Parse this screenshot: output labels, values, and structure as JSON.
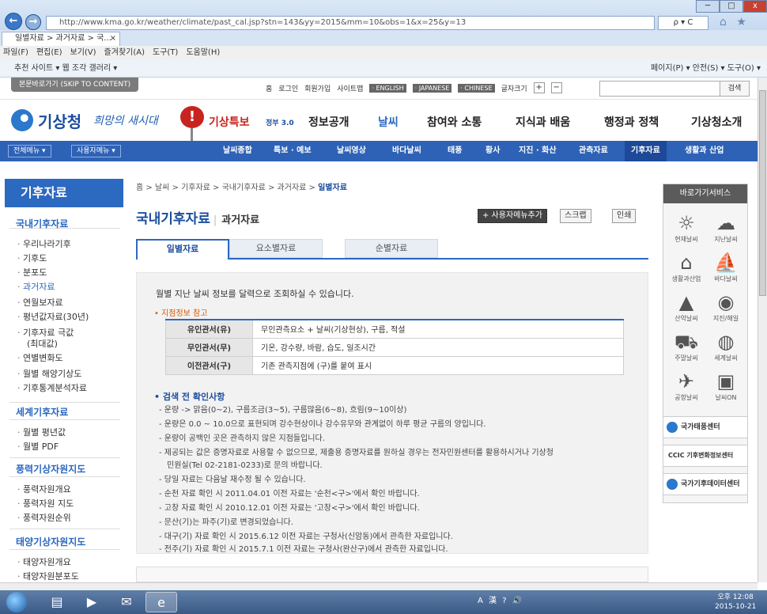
{
  "browser": {
    "back": "←",
    "forward": "→",
    "url": "http://www.kma.go.kr/weather/climate/past_cal.jsp?stn=143&yy=2015&mm=10&obs=1&x=25&y=13",
    "addr_icons": "ρ ▾ C",
    "tab_title": "일별자료 > 과거자료 > 국...",
    "tab_close": "×",
    "home_icons": "⌂ ★ ⚙",
    "win_ctrl": [
      "─",
      "□",
      "x"
    ],
    "menu": [
      "파일(F)",
      "편집(E)",
      "보기(V)",
      "즐겨찾기(A)",
      "도구(T)",
      "도움말(H)"
    ],
    "fav_left": "추천 사이트 ▾   웹 조각 갤러리 ▾",
    "fav_right": "페이지(P) ▾  안전(S) ▾  도구(O) ▾"
  },
  "site": {
    "skip": "본문바로가기 (SKIP TO CONTENT)",
    "toplinks": [
      "홈",
      "로그인",
      "회원가입",
      "사이트맵"
    ],
    "langs": [
      "· ENGLISH",
      "· JAPANESE",
      "· CHINESE"
    ],
    "fontsize": "글자크기",
    "plus": "+",
    "minus": "−",
    "search_btn": "검색",
    "logo": "기상청",
    "slogan": "희망의 새시대",
    "warn_icon": "!",
    "gnb": [
      "기상특보",
      "정보공개",
      "날씨",
      "참여와 소통",
      "지식과 배움",
      "행정과 정책",
      "기상청소개"
    ],
    "gnb_prefix": "정부 3.0",
    "subnav_btns": [
      "전체메뉴 ▾",
      "사용자메뉴 ▾"
    ],
    "subnav": [
      "날씨종합",
      "특보 · 예보",
      "날씨영상",
      "바다날씨",
      "태풍",
      "황사",
      "지진 · 화산",
      "관측자료",
      "기후자료",
      "생활과 산업"
    ]
  },
  "lnb": {
    "title": "기후자료",
    "sections": [
      {
        "title": "국내기후자료",
        "items": [
          "우리나라기후",
          "기후도",
          "분포도",
          "과거자료",
          "연월보자료",
          "평년값자료(30년)",
          "기후자료 극값",
          "(최대값)",
          "연별변화도",
          "월별 해양기상도",
          "기후통계분석자료"
        ]
      },
      {
        "title": "세계기후자료",
        "items": [
          "월별 평년값",
          "월별 PDF"
        ]
      },
      {
        "title": "풍력기상자원지도",
        "items": [
          "풍력자원개요",
          "풍력자원 지도",
          "풍력자원순위"
        ]
      },
      {
        "title": "태양기상자원지도",
        "items": [
          "태양자원개요",
          "태양자원분포도"
        ]
      }
    ]
  },
  "main": {
    "crumb": "홈 > 날씨 > 기후자료 > 국내기후자료 > 과거자료 > ",
    "crumb_current": "일별자료",
    "title": "국내기후자료",
    "subtitle": "과거자료",
    "tools": [
      "+ 사용자메뉴추가",
      "스크랩",
      "인쇄"
    ],
    "tabs": [
      "일별자료",
      "요소별자료",
      "순별자료"
    ],
    "intro": "월별 지난 날씨 정보를 달력으로 조회하실 수 있습니다.",
    "ref_title": "• 지점정보 참고",
    "ref_rows": [
      {
        "h": "유인관서(유)",
        "v": "무인관측요소 + 날씨(기상현상), 구름, 적설"
      },
      {
        "h": "무인관서(무)",
        "v": "기온, 강수량, 바람, 습도, 일조시간"
      },
      {
        "h": "이전관서(구)",
        "v": "기존 관측지점에 (구)를 붙여 표시"
      }
    ],
    "chk_title": "• 검색 전 확인사항",
    "checks": [
      "운량 -> 맑음(0~2), 구름조금(3~5), 구름많음(6~8), 흐림(9~10이상)",
      "운량은 0.0 ~ 10.0으로 표현되며 강수현상이나 강수유무와 관계없이 하루 평균 구름의 양입니다.",
      "운량이 공백인 곳은 관측하지 않은 지점들입니다.",
      "제공되는 값은 증명자료로 사용할 수 없으므로, 제출용 증명자료를 원하실 경우는 전자민원센터를 활용하시거나 기상청",
      "민원실(Tel 02-2181-0233)로 문의 바랍니다.",
      "당일 자료는 다음날 재수정 될 수 있습니다.",
      "순천 자료 확인 시 2011.04.01 이전 자료는 '순천<구>'에서 확인 바랍니다.",
      "고창 자료 확인 시 2010.12.01 이전 자료는 '고창<구>'에서 확인 바랍니다.",
      "문산(기)는 파주(기)로 변경되었습니다.",
      "대구(기) 자료 확인 시 2015.6.12 이전 자료는 구청사(신암동)에서 관측한 자료입니다.",
      "전주(기) 자료 확인 시 2015.7.1 이전 자료는 구청사(완산구)에서 관측한 자료입니다."
    ]
  },
  "quick": {
    "title": "바로가기서비스",
    "items": [
      {
        "label": "현재날씨",
        "icon": "☼"
      },
      {
        "label": "지난날씨",
        "icon": "☁"
      },
      {
        "label": "생활과산업",
        "icon": "⌂"
      },
      {
        "label": "바다날씨",
        "icon": "⛵"
      },
      {
        "label": "산악날씨",
        "icon": "▲"
      },
      {
        "label": "지진/해일",
        "icon": "◉"
      },
      {
        "label": "주말날씨",
        "icon": "⛟"
      },
      {
        "label": "세계날씨",
        "icon": "◍"
      },
      {
        "label": "공항날씨",
        "icon": "✈"
      },
      {
        "label": "날씨ON",
        "icon": "▣"
      }
    ],
    "banners": [
      "국가태풍센터",
      "CCIC 기후변화정보센터",
      "국가기후데이터센터"
    ]
  },
  "taskbar": {
    "tray": "A 漢 ? 🔊",
    "time": "오후 12:08",
    "date": "2015-10-21"
  }
}
